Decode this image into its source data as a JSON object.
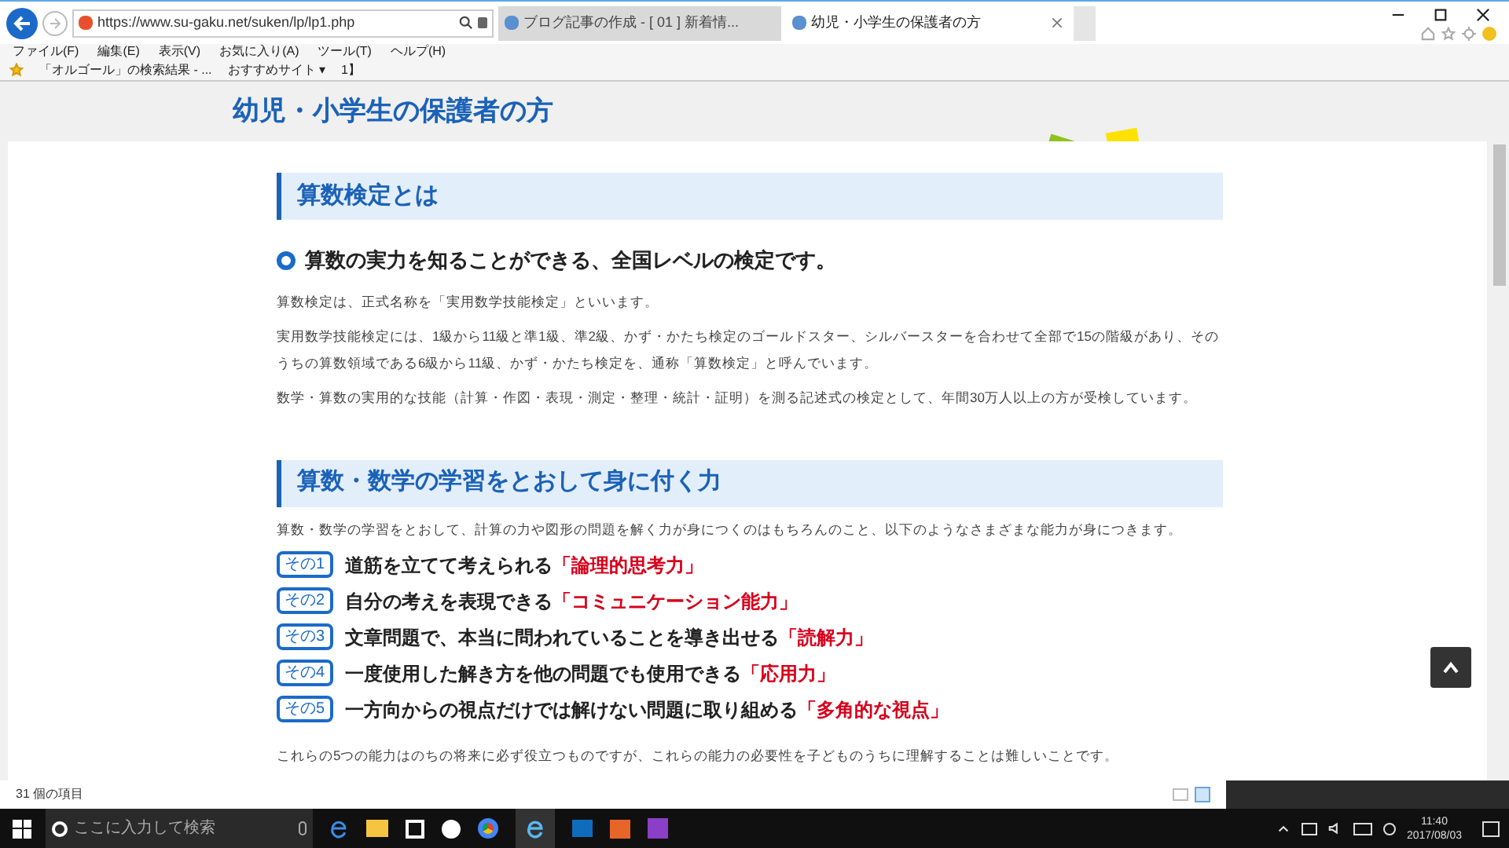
{
  "browser": {
    "address": "https://www.su-gaku.net/suken/lp/lp1.php",
    "tabs": [
      {
        "label": "ブログ記事の作成 - [ 01 ] 新着情...",
        "selected": false
      },
      {
        "label": "幼児・小学生の保護者の方",
        "selected": true
      }
    ],
    "menu": [
      "ファイル(F)",
      "編集(E)",
      "表示(V)",
      "お気に入り(A)",
      "ツール(T)",
      "ヘルプ(H)"
    ],
    "favorites": [
      {
        "label": "「オルゴール」の検索結果 - ..."
      },
      {
        "label": "おすすめサイト ▾"
      },
      {
        "label": "1】"
      }
    ]
  },
  "page": {
    "title": "幼児・小学生の保護者の方",
    "section_1": {
      "heading": "算数検定とは",
      "lead": "算数の実力を知ることができる、全国レベルの検定です。",
      "paragraphs": [
        "算数検定は、正式名称を「実用数学技能検定」といいます。",
        "実用数学技能検定には、1級から11級と準1級、準2級、かず・かたち検定のゴールドスター、シルバースターを合わせて全部で15の階級があり、そのうちの算数領域である6級から11級、かず・かたち検定を、通称「算数検定」と呼んでいます。",
        "数学・算数の実用的な技能（計算・作図・表現・測定・整理・統計・証明）を測る記述式の検定として、年間30万人以上の方が受検しています。"
      ]
    },
    "section_2": {
      "heading": "算数・数学の学習をとおして身に付く力",
      "intro": "算数・数学の学習をとおして、計算の力や図形の問題を解く力が身につくのはもちろんのこと、以下のようなさまざまな能力が身につきます。",
      "items": [
        {
          "badge": "その1",
          "text": "道筋を立てて考えられる",
          "highlight": "「論理的思考力」"
        },
        {
          "badge": "その2",
          "text": "自分の考えを表現できる",
          "highlight": "「コミュニケーション能力」"
        },
        {
          "badge": "その3",
          "text": "文章問題で、本当に問われていることを導き出せる",
          "highlight": "「読解力」"
        },
        {
          "badge": "その4",
          "text": "一度使用した解き方を他の問題でも使用できる",
          "highlight": "「応用力」"
        },
        {
          "badge": "その5",
          "text": "一方向からの視点だけでは解けない問題に取り組める",
          "highlight": "「多角的な視点」"
        }
      ],
      "closing": "これらの5つの能力はのちの将来に必ず役立つものですが、これらの能力の必要性を子どものうちに理解することは難しいことです。"
    }
  },
  "explorer_status": "31 個の項目",
  "taskbar": {
    "search_placeholder": "ここに入力して検索",
    "time": "11:40",
    "date": "2017/08/03"
  }
}
